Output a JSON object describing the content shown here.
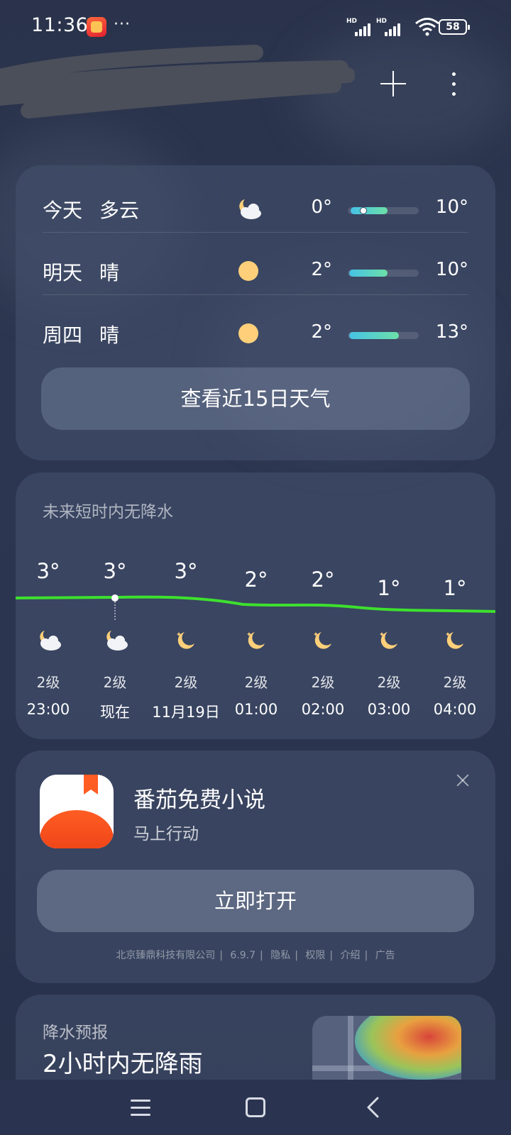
{
  "status_bar": {
    "time": "11:36",
    "more": "···",
    "signal1_label": "HD",
    "signal2_label": "HD",
    "battery": "58"
  },
  "forecast": {
    "days": [
      {
        "day": "今天",
        "condition": "多云",
        "icon": "partly-cloudy-night-icon",
        "low": "0°",
        "high": "10°",
        "range": [
          0.0,
          0.55
        ],
        "current": 0.22
      },
      {
        "day": "明天",
        "condition": "晴",
        "icon": "sun-icon",
        "low": "2°",
        "high": "10°",
        "range": [
          0.0,
          0.55
        ]
      },
      {
        "day": "周四",
        "condition": "晴",
        "icon": "sun-icon",
        "low": "2°",
        "high": "13°",
        "range": [
          0.0,
          0.72
        ]
      }
    ],
    "more_button": "查看近15日天气"
  },
  "hourly": {
    "title": "未来短时内无降水",
    "items": [
      {
        "temp": "3°",
        "wind": "2级",
        "time": "23:00",
        "icon": "partly-cloudy-night-icon"
      },
      {
        "temp": "3°",
        "wind": "2级",
        "time": "现在",
        "icon": "partly-cloudy-night-icon"
      },
      {
        "temp": "3°",
        "wind": "2级",
        "time": "11月19日",
        "icon": "moon-icon"
      },
      {
        "temp": "2°",
        "wind": "2级",
        "time": "01:00",
        "icon": "moon-icon"
      },
      {
        "temp": "2°",
        "wind": "2级",
        "time": "02:00",
        "icon": "moon-icon"
      },
      {
        "temp": "1°",
        "wind": "2级",
        "time": "03:00",
        "icon": "moon-icon"
      },
      {
        "temp": "1°",
        "wind": "2级",
        "time": "04:00",
        "icon": "moon-icon"
      }
    ],
    "line_color": "#3ee02e"
  },
  "ad": {
    "app_name": "番茄免费小说",
    "subtitle": "马上行动",
    "open_button": "立即打开",
    "footer": [
      "北京臻鼎科技有限公司",
      "6.9.7",
      "隐私",
      "权限",
      "介绍",
      "广告"
    ]
  },
  "precip": {
    "label": "降水预报",
    "value": "2小时内无降雨"
  }
}
